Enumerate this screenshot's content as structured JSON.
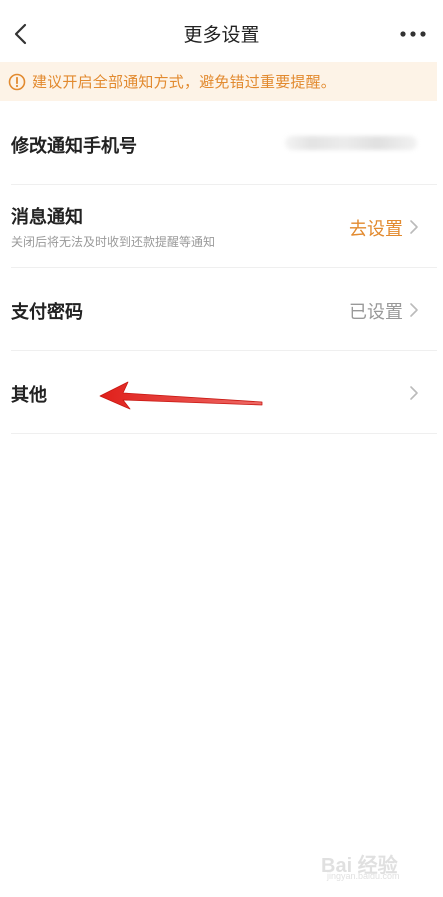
{
  "header": {
    "title": "更多设置",
    "back_icon": "chevron-left-icon",
    "more_icon": "more-dots-icon"
  },
  "notice": {
    "text": "建议开启全部通知方式，避免错过重要提醒。",
    "icon": "warning-circle-icon",
    "color": "#e28a2f",
    "background": "#fdf3e7"
  },
  "rows": [
    {
      "label": "修改通知手机号",
      "value": "",
      "value_blurred": true
    },
    {
      "label": "消息通知",
      "sub": "关闭后将无法及时收到还款提醒等通知",
      "value": "去设置",
      "value_color": "#e28a2f"
    },
    {
      "label": "支付密码",
      "value": "已设置",
      "value_color": "#999999"
    },
    {
      "label": "其他",
      "value": ""
    }
  ],
  "watermark": {
    "text": "Bai 经验",
    "sub": "jingyan.baidu.com"
  },
  "colors": {
    "accent": "#e28a2f",
    "annotation_arrow": "#e0201b"
  }
}
